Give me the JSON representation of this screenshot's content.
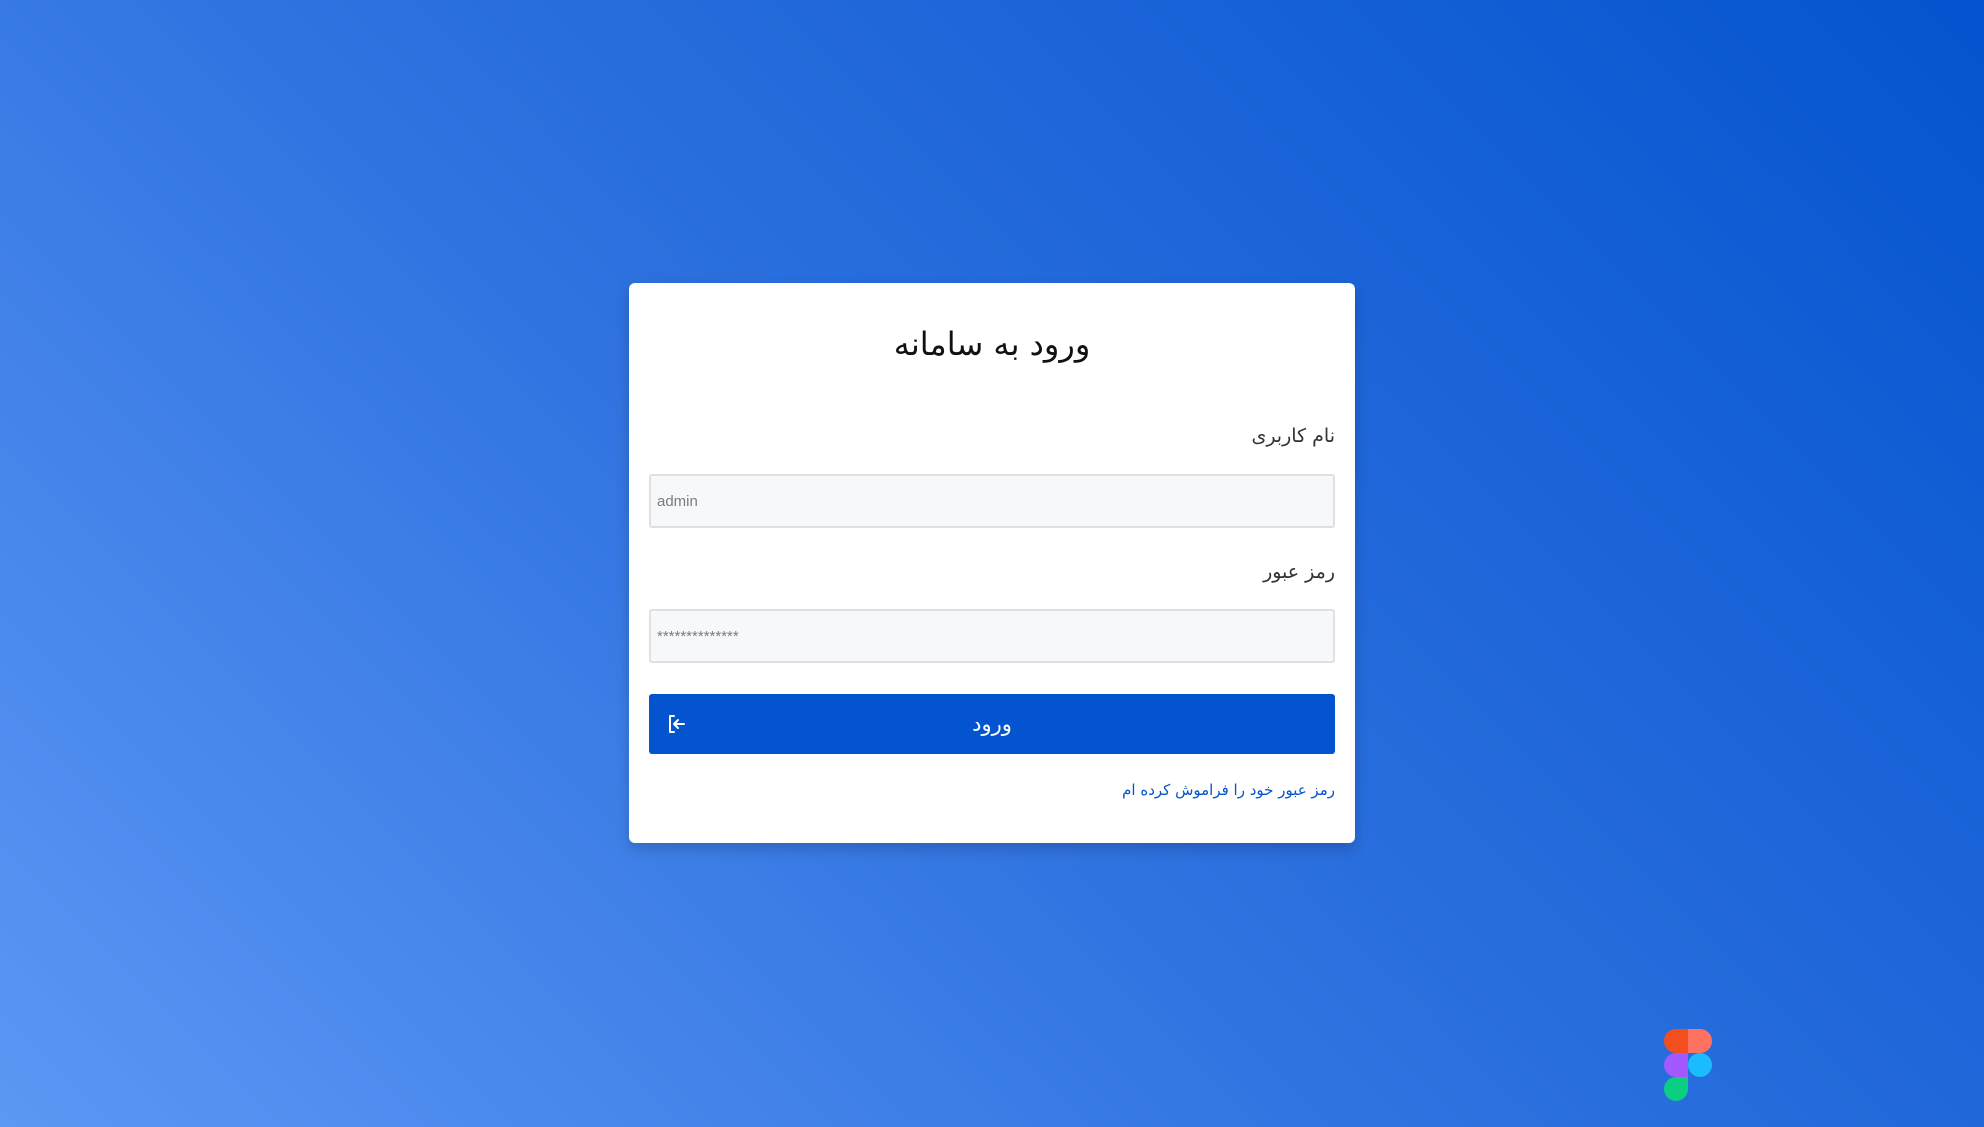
{
  "login": {
    "title": "ورود به سامانه",
    "username_label": "نام کاربری",
    "username_placeholder": "admin",
    "password_label": "رمز عبور",
    "password_placeholder": "**************",
    "submit_label": "ورود",
    "forgot_link": "رمز عبور خود را فراموش کرده ام"
  },
  "icons": {
    "submit": "login-arrow-icon",
    "corner": "figma-logo"
  },
  "colors": {
    "accent": "#0454cf",
    "background_start": "#5b98f5",
    "background_end": "#0454cf",
    "card": "#ffffff",
    "input_bg": "#f7f8fa",
    "input_border": "#dde1e6",
    "figma_red": "#f24e1e",
    "figma_orange": "#ff7262",
    "figma_purple": "#a259ff",
    "figma_blue": "#1abcfe",
    "figma_green": "#0acf83"
  }
}
